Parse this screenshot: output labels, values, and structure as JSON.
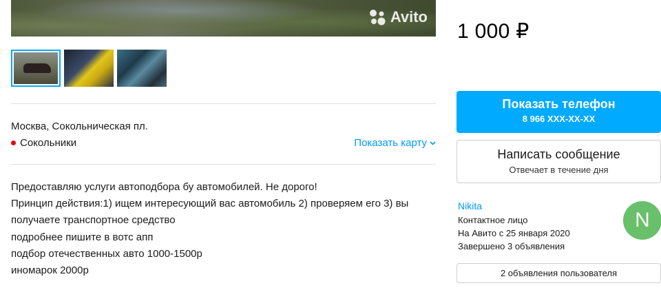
{
  "gallery": {
    "watermark": "Avito",
    "thumbnail_count": 3,
    "selected_thumbnail": 1
  },
  "location": {
    "address": "Москва, Сокольническая пл.",
    "metro": "Сокольники",
    "map_link": "Показать карту",
    "metro_color": "#e30613"
  },
  "description": {
    "lines": [
      "Предоставляю услуги автоподбора бу автомобилей. Не дорого!",
      "Принцип действия:1) ищем интересующий вас автомобиль 2) проверяем его 3) вы",
      "получаете транспортное средство",
      "подробнее пишите в вотс апп",
      "подбор отечественных авто 1000-1500р",
      "иномарок 2000р"
    ]
  },
  "listing": {
    "price": "1 000 ₽"
  },
  "actions": {
    "phone_button_title": "Показать телефон",
    "phone_button_number": "8 966 XXX-XX-XX",
    "message_button_title": "Написать сообщение",
    "message_button_subtitle": "Отвечает в течение дня",
    "user_ads_button": "2 объявления пользователя"
  },
  "seller": {
    "name": "Nikita",
    "type": "Контактное лицо",
    "since": "На Авито с 25 января 2020",
    "completed": "Завершено 3 объявления",
    "avatar_letter": "N",
    "avatar_color": "#69c06b"
  },
  "colors": {
    "accent": "#00aaff",
    "link": "#0099f7"
  }
}
